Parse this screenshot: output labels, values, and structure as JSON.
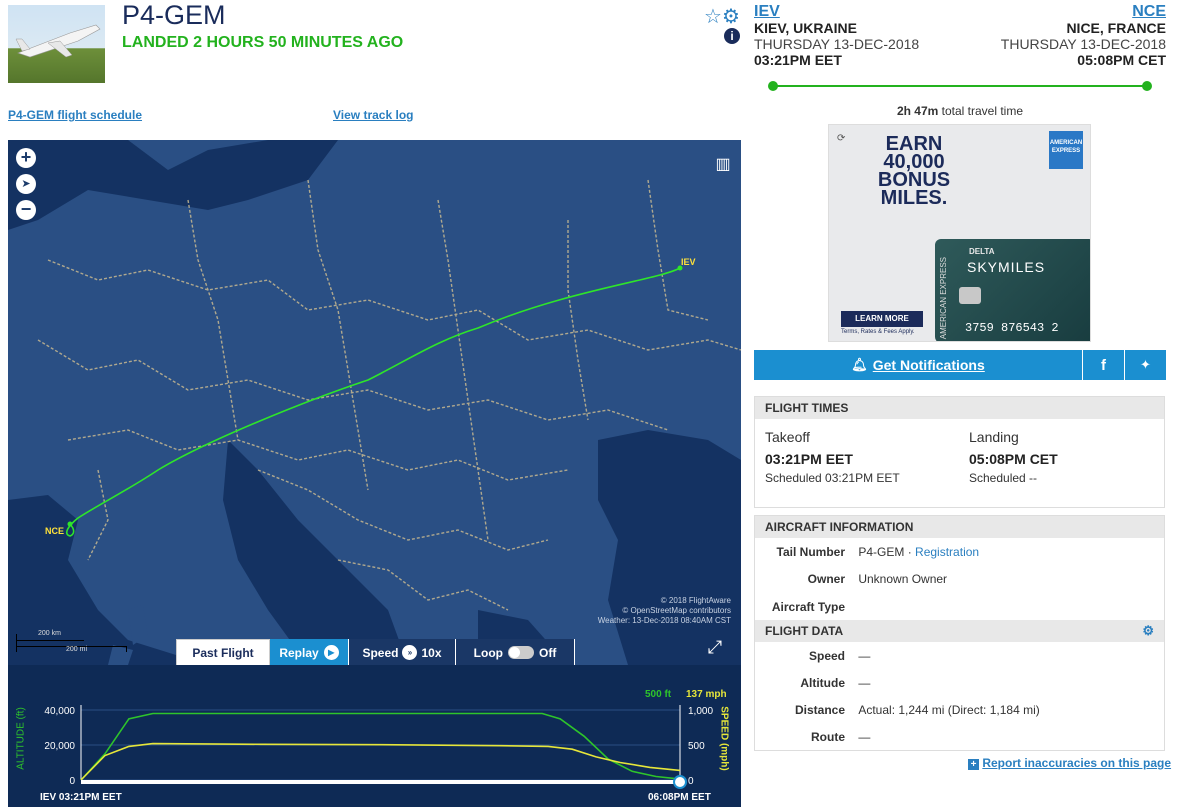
{
  "header": {
    "tail": "P4-GEM",
    "status": "LANDED 2 HOURS 50 MINUTES AGO",
    "icons": [
      "star-icon",
      "gear-icon",
      "info-icon"
    ]
  },
  "origin": {
    "code": "IEV",
    "city": "KIEV, UKRAINE",
    "date": "THURSDAY 13-DEC-2018",
    "time": "03:21PM EET"
  },
  "destination": {
    "code": "NCE",
    "city": "NICE, FRANCE",
    "date": "THURSDAY 13-DEC-2018",
    "time": "05:08PM CET"
  },
  "travel": {
    "duration": "2h 47m",
    "suffix": "total travel time"
  },
  "links": {
    "schedule": "P4-GEM flight schedule",
    "tracklog": "View track log"
  },
  "map": {
    "label_origin": "IEV",
    "label_dest": "NCE",
    "copyright1": "© 2018 FlightAware",
    "copyright2": "© OpenStreetMap contributors",
    "weather": "Weather: 13-Dec-2018 08:40AM CST",
    "scale_km": "200 km",
    "scale_mi": "200 mi",
    "controls": {
      "past": "Past Flight",
      "replay": "Replay",
      "speed": "Speed",
      "speed_val": "10x",
      "loop": "Loop",
      "loop_val": "Off"
    }
  },
  "chart_data": {
    "type": "line",
    "title": "",
    "xlabel": "",
    "ylabel": "ALTITUDE (ft)",
    "y2label": "SPEED (mph)",
    "x_start_label": "IEV 03:21PM EET",
    "x_end_label": "06:08PM EET",
    "y_ticks": [
      "40,000",
      "20,000",
      "0"
    ],
    "y2_ticks": [
      "1,000",
      "500",
      "0"
    ],
    "ylim": [
      0,
      40000
    ],
    "y2lim": [
      0,
      1000
    ],
    "current_altitude": "500 ft",
    "current_speed": "137 mph",
    "series": [
      {
        "name": "Altitude",
        "color": "#2ec42b",
        "unit": "ft",
        "x": [
          0,
          0.04,
          0.08,
          0.12,
          0.3,
          0.5,
          0.7,
          0.77,
          0.8,
          0.84,
          0.88,
          0.92,
          0.96,
          1.0
        ],
        "values": [
          0,
          15000,
          35000,
          38000,
          38000,
          38000,
          38000,
          38000,
          35000,
          25000,
          12000,
          5000,
          2000,
          500
        ]
      },
      {
        "name": "Speed",
        "color": "#e6e63a",
        "unit": "mph",
        "x": [
          0,
          0.04,
          0.08,
          0.12,
          0.3,
          0.5,
          0.7,
          0.78,
          0.82,
          0.86,
          0.9,
          0.95,
          1.0
        ],
        "values": [
          0,
          350,
          480,
          520,
          510,
          505,
          490,
          480,
          440,
          330,
          250,
          180,
          137
        ]
      }
    ]
  },
  "ad": {
    "line1": "EARN",
    "line2": "40,000",
    "line3": "BONUS",
    "line4": "MILES.",
    "brand": "DELTA",
    "card": "SKYMILES",
    "number": "3759 876543 2",
    "issuer": "AMERICAN EXPRESS",
    "cta": "LEARN MORE",
    "fine": "Terms, Rates & Fees Apply."
  },
  "notifications": {
    "label": "Get Notifications"
  },
  "flight_times": {
    "header": "FLIGHT TIMES",
    "takeoff_label": "Takeoff",
    "takeoff_time": "03:21PM EET",
    "takeoff_sched": "Scheduled 03:21PM EET",
    "landing_label": "Landing",
    "landing_time": "05:08PM CET",
    "landing_sched": "Scheduled --"
  },
  "aircraft": {
    "header": "AIRCRAFT INFORMATION",
    "tail_label": "Tail Number",
    "tail_val": "P4-GEM",
    "reg_link": "Registration",
    "owner_label": "Owner",
    "owner_val": "Unknown Owner",
    "type_label": "Aircraft Type"
  },
  "flight_data": {
    "header": "FLIGHT DATA",
    "speed_label": "Speed",
    "speed_val": "—",
    "alt_label": "Altitude",
    "alt_val": "—",
    "dist_label": "Distance",
    "dist_val": "Actual: 1,244 mi (Direct: 1,184 mi)",
    "route_label": "Route",
    "route_val": "—"
  },
  "report": {
    "label": "Report inaccuracies on this page"
  }
}
